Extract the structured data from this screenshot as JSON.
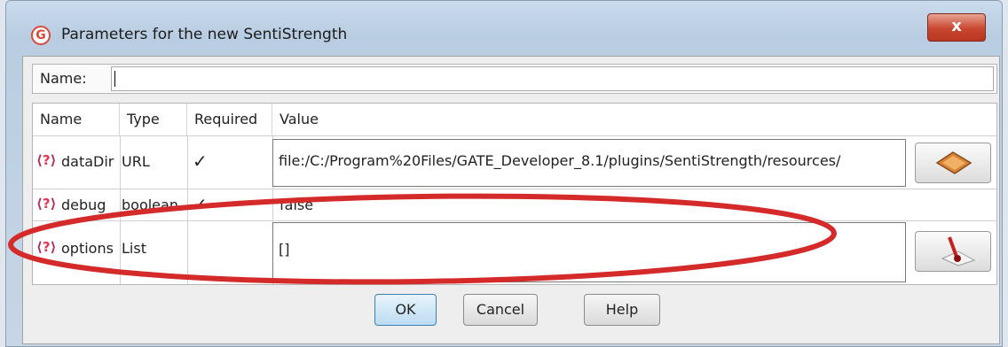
{
  "window": {
    "title": "Parameters for the new SentiStrength",
    "app_icon_text": "G",
    "close_glyph": "x"
  },
  "name_field": {
    "label": "Name:",
    "value": ""
  },
  "table": {
    "headers": [
      "Name",
      "Type",
      "Required",
      "Value"
    ],
    "rows": [
      {
        "name": "dataDir",
        "type": "URL",
        "required": "✓",
        "value": "file:/C:/Program%20Files/GATE_Developer_8.1/plugins/SentiStrength/resources/"
      },
      {
        "name": "debug",
        "type": "boolean",
        "required": "✓",
        "value": "false"
      },
      {
        "name": "options",
        "type": "List",
        "required": "",
        "value": "[]"
      }
    ],
    "info_glyph": "?"
  },
  "buttons": {
    "ok": "OK",
    "cancel": "Cancel",
    "help": "Help"
  },
  "colors": {
    "annotation_ellipse": "#d42a2a",
    "close_button": "#c8462f",
    "accent": "#3c7fb1"
  },
  "icons": [
    "gate-app-icon",
    "close-icon",
    "help-parameter-icon",
    "browse-folder-icon",
    "list-edit-icon"
  ]
}
